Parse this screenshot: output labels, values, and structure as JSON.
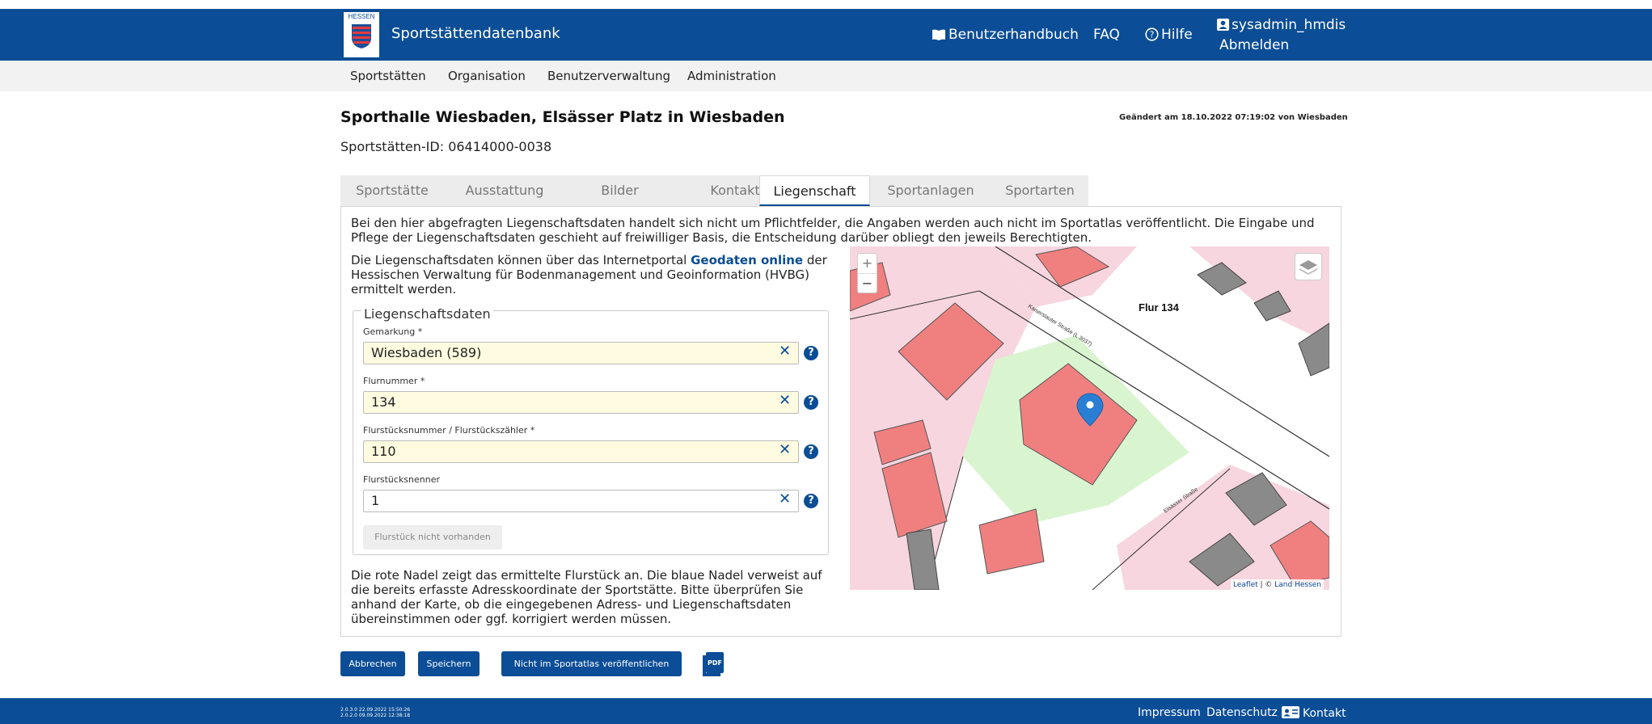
{
  "header": {
    "logo_text": "HESSEN",
    "app_name": "Sportstättendatenbank",
    "nav": {
      "handbook": "Benutzerhandbuch",
      "faq": "FAQ",
      "help": "Hilfe"
    },
    "user": {
      "name": "sysadmin_hmdis",
      "logout": "Abmelden"
    },
    "brand_color": "#0b4d96"
  },
  "subnav": {
    "items": [
      "Sportstätten",
      "Organisation",
      "Benutzerverwaltung",
      "Administration"
    ]
  },
  "page": {
    "title": "Sporthalle Wiesbaden, Elsässer Platz in Wiesbaden",
    "changed": "Geändert am 18.10.2022 07:19:02 von Wiesbaden",
    "site_id": "Sportstätten-ID: 06414000-0038"
  },
  "tabs": [
    {
      "label": "Sportstätte",
      "active": false
    },
    {
      "label": "Ausstattung",
      "active": false
    },
    {
      "label": "Bilder",
      "active": false
    },
    {
      "label": "Kontakt",
      "active": false
    },
    {
      "label": "Liegenschaft",
      "active": true
    },
    {
      "label": "Sportanlagen",
      "active": false
    },
    {
      "label": "Sportarten",
      "active": false
    }
  ],
  "content": {
    "intro": "Bei den hier abgefragten Liegenschaftsdaten handelt sich nicht um Pflichtfelder, die Angaben werden auch nicht im Sportatlas veröffentlicht. Die Eingabe und Pflege der Liegenschaftsdaten geschieht auf freiwilliger Basis, die Entscheidung darüber obliegt den jeweils Berechtigten.",
    "geo_pre": "Die Liegenschaftsdaten können über das Internetportal ",
    "geo_link": "Geodaten online",
    "geo_post": " der Hessischen Verwaltung für Bodenmanagement und Geoinformation (HVBG) ermittelt werden.",
    "fieldset_legend": "Liegenschaftsdaten",
    "fields": [
      {
        "label": "Gemarkung *",
        "value": "Wiesbaden (589)"
      },
      {
        "label": "Flurnummer *",
        "value": "134"
      },
      {
        "label": "Flurstücksnummer / Flurstückszähler *",
        "value": "110"
      },
      {
        "label": "Flurstücksnenner",
        "value": "1"
      }
    ],
    "clear_symbol": "✕",
    "help_symbol": "?",
    "missing_button": "Flurstück nicht vorhanden",
    "outro": "Die rote Nadel zeigt das ermittelte Flurstück an. Die blaue Nadel verweist auf die bereits erfasste Adresskoordinate der Sportstätte. Bitte überprüfen Sie anhand der Karte, ob die eingegebenen Adress- und Liegenschaftsdaten übereinstimmen oder ggf. korrigiert werden müssen."
  },
  "map": {
    "zoom_in": "+",
    "zoom_out": "−",
    "flur_label": "Flur 134",
    "street_1": "Kaiserslauter Straße (L 3037)",
    "street_2": "Elsässer Straße",
    "attribution_leaflet": "Leaflet",
    "attribution_sep": " | © ",
    "attribution_source": "Land Hessen",
    "building_color": "#f08080",
    "parcel_color": "#f7d6df",
    "park_color": "#d9f5d0"
  },
  "actions": {
    "cancel": "Abbrechen",
    "save": "Speichern",
    "not_publish": "Nicht im Sportatlas veröffentlichen",
    "pdf_label": "PDF"
  },
  "footer": {
    "version_1": "2.0.3.0 22.09.2022 15:50:26",
    "version_2": "2.0.2.0 09.09.2022 12:38:18",
    "imprint": "Impressum",
    "privacy": "Datenschutz",
    "contact": "Kontakt"
  }
}
